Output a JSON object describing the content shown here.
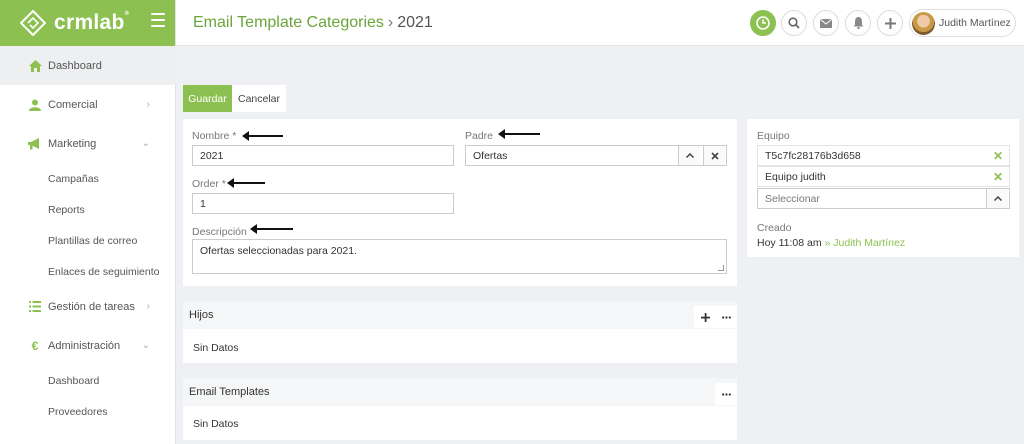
{
  "brand": {
    "name": "crmlab",
    "mark": "®",
    "accent": "#8cc152"
  },
  "sidebar": {
    "items": [
      {
        "label": "Dashboard",
        "icon": "home-icon",
        "active": true
      },
      {
        "label": "Comercial",
        "icon": "user-icon",
        "chevron": "›"
      },
      {
        "label": "Marketing",
        "icon": "megaphone-icon",
        "chevron": "⌄"
      },
      {
        "label": "Campañas",
        "sub": true
      },
      {
        "label": "Reports",
        "sub": true
      },
      {
        "label": "Plantillas de correo",
        "sub": true
      },
      {
        "label": "Enlaces de seguimiento",
        "sub": true
      },
      {
        "label": "Gestión de tareas",
        "icon": "list-icon",
        "chevron": "›"
      },
      {
        "label": "Administración",
        "icon": "euro-icon",
        "chevron": "⌄"
      },
      {
        "label": "Dashboard",
        "sub": true
      },
      {
        "label": "Proveedores",
        "sub": true
      }
    ]
  },
  "header": {
    "breadcrumb": "Email Template Categories",
    "separator": "›",
    "record": "2021",
    "user_name": "Judith Martínez"
  },
  "toolbar": {
    "save_label": "Guardar",
    "cancel_label": "Cancelar"
  },
  "form": {
    "nombre_label": "Nombre *",
    "nombre_value": "2021",
    "padre_label": "Padre",
    "padre_value": "Ofertas",
    "order_label": "Order *",
    "order_value": "1",
    "descripcion_label": "Descripción",
    "descripcion_value": "Ofertas seleccionadas para 2021."
  },
  "hijos": {
    "title": "Hijos",
    "empty": "Sin Datos"
  },
  "email_templates": {
    "title": "Email Templates",
    "empty": "Sin Datos"
  },
  "side_panel": {
    "equipo_label": "Equipo",
    "teams": [
      "T5c7fc28176b3d658",
      "Equipo judith"
    ],
    "select_placeholder": "Seleccionar",
    "creado_label": "Creado",
    "creado_time": "Hoy 11:08 am",
    "creado_sep": "»",
    "creado_user": "Judith Martínez"
  }
}
